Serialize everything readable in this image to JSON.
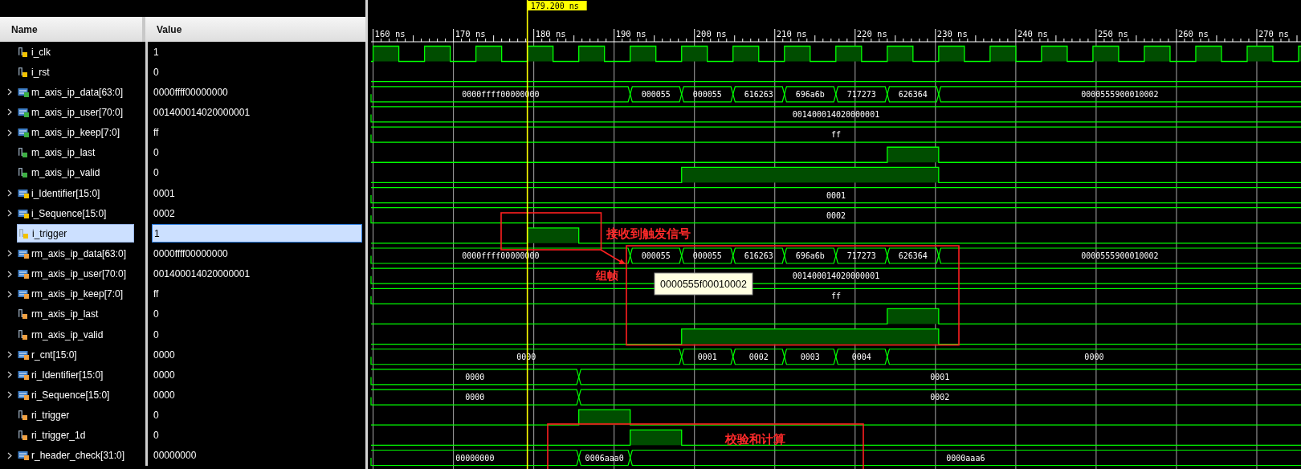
{
  "columns": {
    "name": "Name",
    "value": "Value"
  },
  "ruler": {
    "ticks": [
      "160 ns",
      "170 ns",
      "180 ns",
      "190 ns",
      "200 ns",
      "210 ns",
      "220 ns",
      "230 ns",
      "240 ns",
      "250 ns",
      "260 ns",
      "270 ns"
    ]
  },
  "cursor": {
    "label": "179.200 ns"
  },
  "signals": [
    {
      "name": "i_clk",
      "value": "1",
      "kind": "bit",
      "color": "#f2c200",
      "selected": false
    },
    {
      "name": "i_rst",
      "value": "0",
      "kind": "bit",
      "color": "#f2c200",
      "selected": false
    },
    {
      "name": "m_axis_ip_data[63:0]",
      "value": "0000ffff00000000",
      "kind": "bus",
      "color": "#3cb043",
      "selected": false,
      "segments": [
        {
          "label": "0000ffff00000000"
        },
        {
          "label": "000055"
        },
        {
          "label": "000055"
        },
        {
          "label": "616263"
        },
        {
          "label": "696a6b"
        },
        {
          "label": "717273"
        },
        {
          "label": "626364"
        },
        {
          "label": "0000555900010002"
        }
      ]
    },
    {
      "name": "m_axis_ip_user[70:0]",
      "value": "001400014020000001",
      "kind": "bus",
      "color": "#3cb043",
      "selected": false,
      "segments": [
        {
          "label": "001400014020000001"
        }
      ]
    },
    {
      "name": "m_axis_ip_keep[7:0]",
      "value": "ff",
      "kind": "bus",
      "color": "#3cb043",
      "selected": false,
      "segments": [
        {
          "label": "ff"
        }
      ]
    },
    {
      "name": "m_axis_ip_last",
      "value": "0",
      "kind": "bit",
      "color": "#3cb043",
      "selected": false
    },
    {
      "name": "m_axis_ip_valid",
      "value": "0",
      "kind": "bit",
      "color": "#3cb043",
      "selected": false
    },
    {
      "name": "i_Identifier[15:0]",
      "value": "0001",
      "kind": "bus",
      "color": "#f2c200",
      "selected": false,
      "segments": [
        {
          "label": "0001"
        }
      ]
    },
    {
      "name": "i_Sequence[15:0]",
      "value": "0002",
      "kind": "bus",
      "color": "#f2c200",
      "selected": false,
      "segments": [
        {
          "label": "0002"
        }
      ]
    },
    {
      "name": "i_trigger",
      "value": "1",
      "kind": "bit",
      "color": "#f2c200",
      "selected": true
    },
    {
      "name": "rm_axis_ip_data[63:0]",
      "value": "0000ffff00000000",
      "kind": "bus",
      "color": "#f0a040",
      "selected": false,
      "segments": [
        {
          "label": "0000ffff00000000"
        },
        {
          "label": "000055"
        },
        {
          "label": "000055"
        },
        {
          "label": "616263"
        },
        {
          "label": "696a6b"
        },
        {
          "label": "717273"
        },
        {
          "label": "626364"
        },
        {
          "label": "0000555900010002"
        }
      ]
    },
    {
      "name": "rm_axis_ip_user[70:0]",
      "value": "001400014020000001",
      "kind": "bus",
      "color": "#f0a040",
      "selected": false,
      "segments": [
        {
          "label": "001400014020000001"
        }
      ]
    },
    {
      "name": "rm_axis_ip_keep[7:0]",
      "value": "ff",
      "kind": "bus",
      "color": "#f0a040",
      "selected": false,
      "segments": [
        {
          "label": "ff"
        }
      ]
    },
    {
      "name": "rm_axis_ip_last",
      "value": "0",
      "kind": "bit",
      "color": "#f0a040",
      "selected": false
    },
    {
      "name": "rm_axis_ip_valid",
      "value": "0",
      "kind": "bit",
      "color": "#f0a040",
      "selected": false
    },
    {
      "name": "r_cnt[15:0]",
      "value": "0000",
      "kind": "bus",
      "color": "#f0a040",
      "selected": false,
      "segments": [
        {
          "label": "0000"
        },
        {
          "label": "0001"
        },
        {
          "label": "0002"
        },
        {
          "label": "0003"
        },
        {
          "label": "0004"
        },
        {
          "label": "0000"
        }
      ]
    },
    {
      "name": "ri_Identifier[15:0]",
      "value": "0000",
      "kind": "bus",
      "color": "#f0a040",
      "selected": false,
      "segments": [
        {
          "label": "0000"
        },
        {
          "label": "0001"
        }
      ]
    },
    {
      "name": "ri_Sequence[15:0]",
      "value": "0000",
      "kind": "bus",
      "color": "#f0a040",
      "selected": false,
      "segments": [
        {
          "label": "0000"
        },
        {
          "label": "0002"
        }
      ]
    },
    {
      "name": "ri_trigger",
      "value": "0",
      "kind": "bit",
      "color": "#f0a040",
      "selected": false
    },
    {
      "name": "ri_trigger_1d",
      "value": "0",
      "kind": "bit",
      "color": "#f0a040",
      "selected": false
    },
    {
      "name": "r_header_check[31:0]",
      "value": "00000000",
      "kind": "bus",
      "color": "#f0a040",
      "selected": false,
      "segments": [
        {
          "label": "00000000"
        },
        {
          "label": "0006aaa0"
        },
        {
          "label": "0000aaa6"
        }
      ]
    }
  ],
  "annotations": [
    {
      "text": "接收到触发信号"
    },
    {
      "text": "组帧"
    },
    {
      "text": "校验和计算"
    }
  ],
  "tooltip": {
    "text": "0000555f00010002"
  }
}
